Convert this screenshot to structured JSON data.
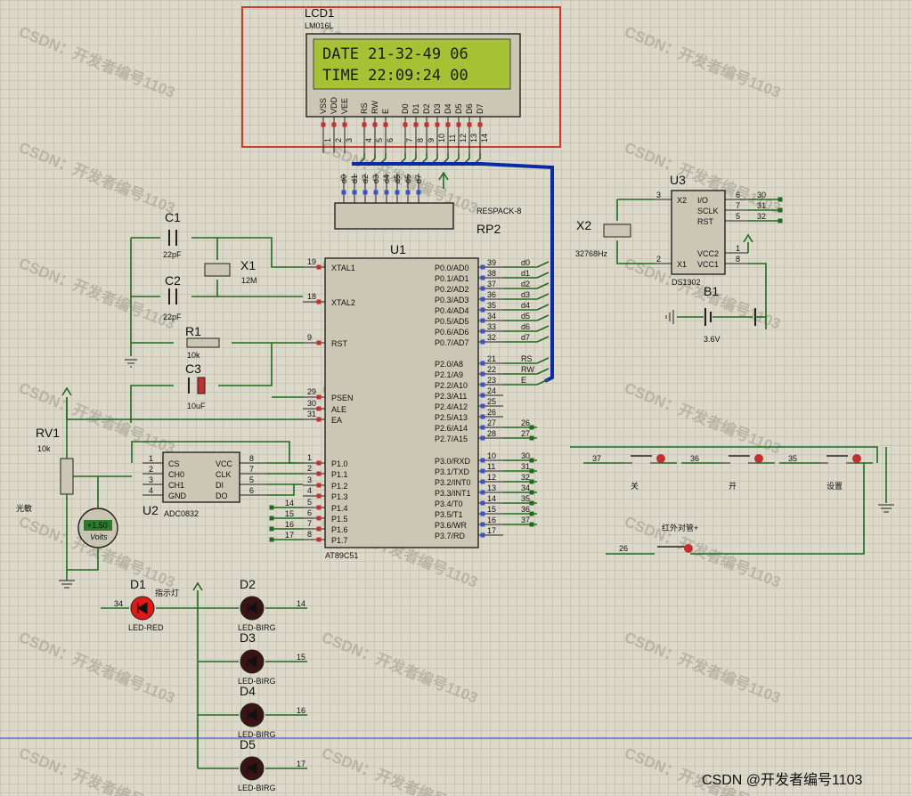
{
  "lcd": {
    "ref": "LCD1",
    "model": "LM016L",
    "line1": "DATE 21-32-49 06",
    "line2": "TIME 22:09:24 00",
    "pins": [
      "VSS",
      "VDD",
      "VEE",
      "RS",
      "RW",
      "E",
      "D0",
      "D1",
      "D2",
      "D3",
      "D4",
      "D5",
      "D6",
      "D7"
    ],
    "pin_numbers": [
      "1",
      "2",
      "3",
      "4",
      "5",
      "6",
      "7",
      "8",
      "9",
      "10",
      "11",
      "12",
      "13",
      "14"
    ]
  },
  "rp2": {
    "ref": "RP2",
    "model": "RESPACK-8",
    "pins": [
      "d0",
      "d1",
      "d2",
      "d3",
      "d4",
      "d5",
      "d6",
      "d7"
    ]
  },
  "u1": {
    "ref": "U1",
    "model": "AT89C51",
    "left_pins": [
      [
        "19",
        "XTAL1"
      ],
      [
        "18",
        "XTAL2"
      ],
      [
        "9",
        "RST"
      ],
      [
        "29",
        "PSEN"
      ],
      [
        "30",
        "ALE"
      ],
      [
        "31",
        "EA"
      ],
      [
        "1",
        "P1.0"
      ],
      [
        "2",
        "P1.1"
      ],
      [
        "3",
        "P1.2"
      ],
      [
        "4",
        "P1.3"
      ],
      [
        "5",
        "P1.4"
      ],
      [
        "6",
        "P1.5"
      ],
      [
        "7",
        "P1.6"
      ],
      [
        "8",
        "P1.7"
      ]
    ],
    "right_pins": [
      [
        "39",
        "P0.0/AD0",
        "d0"
      ],
      [
        "38",
        "P0.1/AD1",
        "d1"
      ],
      [
        "37",
        "P0.2/AD2",
        "d2"
      ],
      [
        "36",
        "P0.3/AD3",
        "d3"
      ],
      [
        "35",
        "P0.4/AD4",
        "d4"
      ],
      [
        "34",
        "P0.5/AD5",
        "d5"
      ],
      [
        "33",
        "P0.6/AD6",
        "d6"
      ],
      [
        "32",
        "P0.7/AD7",
        "d7"
      ],
      [
        "21",
        "P2.0/A8",
        "RS"
      ],
      [
        "22",
        "P2.1/A9",
        "RW"
      ],
      [
        "23",
        "P2.2/A10",
        "E"
      ],
      [
        "24",
        "P2.3/A11",
        ""
      ],
      [
        "25",
        "P2.4/A12",
        ""
      ],
      [
        "26",
        "P2.5/A13",
        ""
      ],
      [
        "27",
        "P2.6/A14",
        "26"
      ],
      [
        "28",
        "P2.7/A15",
        "27"
      ],
      [
        "10",
        "P3.0/RXD",
        "30"
      ],
      [
        "11",
        "P3.1/TXD",
        "31"
      ],
      [
        "12",
        "P3.2/INT0",
        "32"
      ],
      [
        "13",
        "P3.3/INT1",
        "34"
      ],
      [
        "14",
        "P3.4/T0",
        "35"
      ],
      [
        "15",
        "P3.5/T1",
        "36"
      ],
      [
        "16",
        "P3.6/WR",
        "37"
      ],
      [
        "17",
        "P3.7/RD",
        ""
      ]
    ],
    "p1_nets": [
      "14",
      "15",
      "16",
      "17"
    ]
  },
  "c1": {
    "ref": "C1",
    "value": "22pF"
  },
  "c2": {
    "ref": "C2",
    "value": "22pF"
  },
  "c3": {
    "ref": "C3",
    "value": "10uF"
  },
  "x1": {
    "ref": "X1",
    "value": "12M"
  },
  "r1": {
    "ref": "R1",
    "value": "10k"
  },
  "rv1": {
    "ref": "RV1",
    "value": "10k",
    "note": "光敏"
  },
  "u2": {
    "ref": "U2",
    "model": "ADC0832",
    "left": [
      "CS",
      "CH0",
      "CH1",
      "GND"
    ],
    "left_nums": [
      "1",
      "2",
      "3",
      "4"
    ],
    "right": [
      "VCC",
      "CLK",
      "DI",
      "DO"
    ],
    "right_nums": [
      "8",
      "7",
      "5",
      "6"
    ]
  },
  "voltmeter": {
    "value": "+1.50",
    "unit": "Volts"
  },
  "u3": {
    "ref": "U3",
    "model": "DS1302",
    "left": [
      "X2",
      "X1"
    ],
    "left_nums": [
      "3",
      "2"
    ],
    "right": [
      "I/O",
      "SCLK",
      "RST",
      "VCC2",
      "VCC1"
    ],
    "right_nums": [
      "6",
      "7",
      "5",
      "1",
      "8"
    ],
    "nets": [
      "30",
      "31",
      "32"
    ]
  },
  "x2": {
    "ref": "X2",
    "value": "32768Hz"
  },
  "b1": {
    "ref": "B1",
    "value": "3.6V"
  },
  "leds": [
    {
      "ref": "D1",
      "note": "指示灯",
      "model": "LED-RED",
      "net": "34"
    },
    {
      "ref": "D2",
      "model": "LED-BIRG",
      "net": "14"
    },
    {
      "ref": "D3",
      "model": "LED-BIRG",
      "net": "15"
    },
    {
      "ref": "D4",
      "model": "LED-BIRG",
      "net": "16"
    },
    {
      "ref": "D5",
      "model": "LED-BIRG",
      "net": "17"
    }
  ],
  "buttons": [
    {
      "label": "关",
      "net": "37"
    },
    {
      "label": "开",
      "net": "36"
    },
    {
      "label": "设置",
      "net": "35"
    },
    {
      "label": "红外对管+",
      "net": "26"
    }
  ],
  "watermark": "CSDN：开发者编号1103",
  "footer": "CSDN @开发者编号1103"
}
